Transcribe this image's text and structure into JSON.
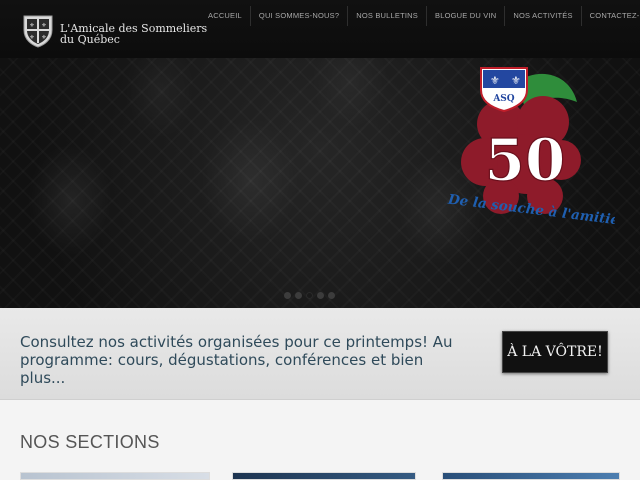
{
  "site": {
    "name_line1": "L'Amicale des Sommeliers",
    "name_line2": "du Québec",
    "emblem_number": "50",
    "emblem_tagline": "De la souche à l'amitié",
    "emblem_shield_letters": "ASQ"
  },
  "nav": {
    "items": [
      {
        "label": "ACCUEIL"
      },
      {
        "label": "QUI SOMMES-NOUS?"
      },
      {
        "label": "NOS BULLETINS"
      },
      {
        "label": "BLOGUE DU VIN"
      },
      {
        "label": "NOS ACTIVITÉS"
      },
      {
        "label": "CONTACTEZ-NOUS"
      }
    ]
  },
  "slider": {
    "slides": 5,
    "active_index": 2
  },
  "promo": {
    "text": "Consultez nos activités organisées pour ce printemps! Au programme: cours, dégustations, conférences et bien plus...",
    "cta_label": "À LA VÔTRE!"
  },
  "sections": {
    "title": "NOS SECTIONS"
  },
  "colors": {
    "header_bg": "#141414",
    "promo_text": "#2f4a5a",
    "grape": "#8e1b2a",
    "leaf": "#2f8d3b",
    "tagline_blue": "#1f5fb0"
  },
  "icons": {
    "brand": "fleur-de-lis-shield-icon"
  }
}
